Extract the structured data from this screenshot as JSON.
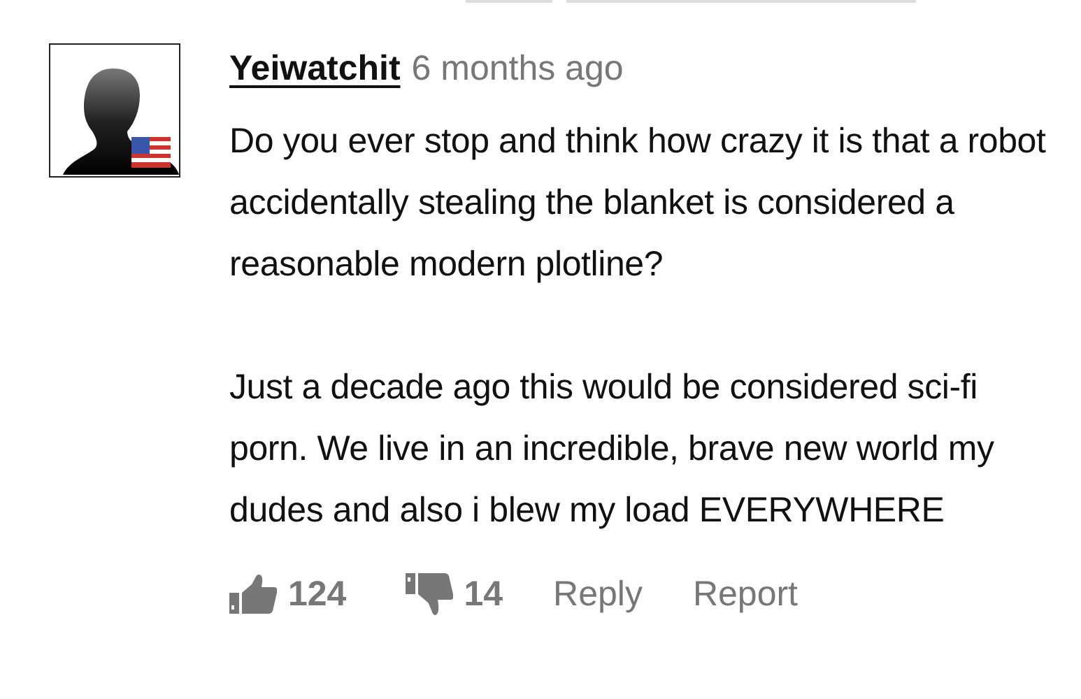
{
  "comment": {
    "author": "Yeiwatchit",
    "time": "6 months ago",
    "paragraphs": [
      "Do you ever stop and think how crazy it is that a robot accidentally stealing the blanket is considered a reasonable modern plotline?",
      "Just a decade ago this would be considered sci-fi porn. We live in an incredible, brave new world my dudes and also i blew my load EVERYWHERE"
    ],
    "likes": "124",
    "dislikes": "14",
    "actions": [
      "Reply",
      "Report"
    ]
  }
}
